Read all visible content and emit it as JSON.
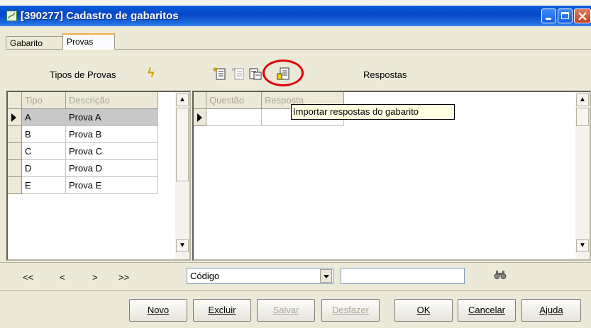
{
  "window": {
    "title": "[390277]  Cadastro de gabaritos"
  },
  "tabs": [
    {
      "label": "Gabarito"
    },
    {
      "label": "Provas"
    }
  ],
  "left_panel": {
    "header": "Tipos de Provas",
    "columns": [
      "Tipo",
      "Descrição"
    ],
    "rows": [
      {
        "tipo": "A",
        "descricao": "Prova A"
      },
      {
        "tipo": "B",
        "descricao": "Prova B"
      },
      {
        "tipo": "C",
        "descricao": "Prova C"
      },
      {
        "tipo": "D",
        "descricao": "Prova D"
      },
      {
        "tipo": "E",
        "descricao": "Prova E"
      }
    ]
  },
  "right_panel": {
    "header": "Respostas",
    "columns": [
      "Questão",
      "Resposta"
    ],
    "tooltip": "Importar respostas do gabarito"
  },
  "nav": {
    "first": "<<",
    "prev": "<",
    "next": ">",
    "last": ">>",
    "search_field": "Código",
    "search_value": ""
  },
  "buttons": {
    "novo": "Novo",
    "excluir": "Excluir",
    "salvar": "Salvar",
    "desfazer": "Desfazer",
    "ok": "OK",
    "cancelar": "Cancelar",
    "ajuda": "Ajuda"
  },
  "colors": {
    "titlebar": "#0546c9",
    "highlight": "#e00000",
    "tooltip_bg": "#ffffe1"
  }
}
